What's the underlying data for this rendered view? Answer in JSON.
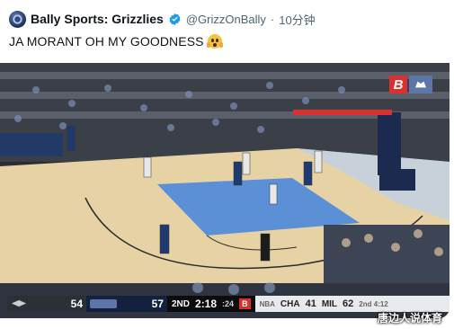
{
  "tweet": {
    "display_name": "Bally Sports: Grizzlies",
    "handle": "@GrizzOnBally",
    "separator": "·",
    "timestamp": "10分钟",
    "text": "JA MORANT OH MY GOODNESS",
    "emoji": "face-screaming-in-fear"
  },
  "scoreboard": {
    "team_a_score": "54",
    "team_b_score": "57",
    "quarter": "2ND",
    "clock": "2:18",
    "shot_clock": ":24",
    "network_logo": "B",
    "other_games": [
      {
        "label": "NBA",
        "team": "CHA",
        "score": "41"
      },
      {
        "label": "MIL",
        "score": "62",
        "status": "2nd 4:12"
      }
    ]
  },
  "broadcast": {
    "corner_logo": "B"
  },
  "watermark": "唐边人说体育",
  "colors": {
    "verified": "#1d9bf0",
    "court": "#e9d5a8",
    "paint": "#5b8fd6",
    "grizzlies_navy": "#13213f",
    "bally_red": "#d8312f"
  }
}
